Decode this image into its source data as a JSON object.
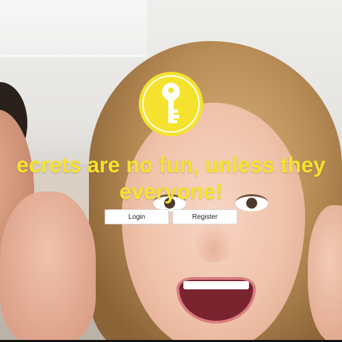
{
  "hero": {
    "tagline_line1": "ecrets are no fun, unless they",
    "tagline_line2": "everyone!"
  },
  "actions": {
    "login_label": "Login",
    "register_label": "Register"
  },
  "colors": {
    "brand_yellow": "#f5e22e",
    "button_bg": "#ffffff"
  },
  "icons": {
    "logo": "key-icon"
  }
}
